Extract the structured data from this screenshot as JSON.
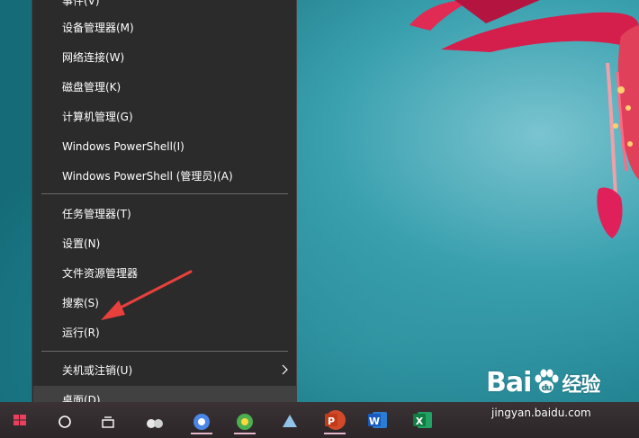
{
  "menu": {
    "top_cut_label": "事件(V)",
    "items": [
      {
        "label": "设备管理器(M)"
      },
      {
        "label": "网络连接(W)"
      },
      {
        "label": "磁盘管理(K)"
      },
      {
        "label": "计算机管理(G)"
      },
      {
        "label": "Windows PowerShell(I)"
      },
      {
        "label": "Windows PowerShell (管理员)(A)"
      },
      {
        "label": "任务管理器(T)"
      },
      {
        "label": "设置(N)"
      },
      {
        "label": "文件资源管理器"
      },
      {
        "label": "搜索(S)"
      },
      {
        "label": "运行(R)"
      },
      {
        "label": "关机或注销(U)"
      },
      {
        "label": "桌面(D)"
      }
    ]
  },
  "taskbar": {
    "apps": [
      {
        "icon": "windows-start-icon"
      },
      {
        "icon": "search-circle-icon"
      },
      {
        "icon": "task-view-icon"
      },
      {
        "icon": "app-icon"
      },
      {
        "icon": "chrome-icon"
      },
      {
        "icon": "browser-icon"
      },
      {
        "icon": "app-icon"
      },
      {
        "icon": "powerpoint-icon",
        "letter": "P"
      },
      {
        "icon": "word-icon",
        "letter": "W"
      },
      {
        "icon": "excel-icon",
        "letter": "X"
      }
    ]
  },
  "watermark": {
    "logo_left": "Bai",
    "logo_right": "经验",
    "url": "jingyan.baidu.com"
  },
  "colors": {
    "menu_bg": "#2b2b2b",
    "menu_hover": "#414141",
    "annotation_arrow": "#e8403c",
    "desktop": "#1e7f8c"
  }
}
